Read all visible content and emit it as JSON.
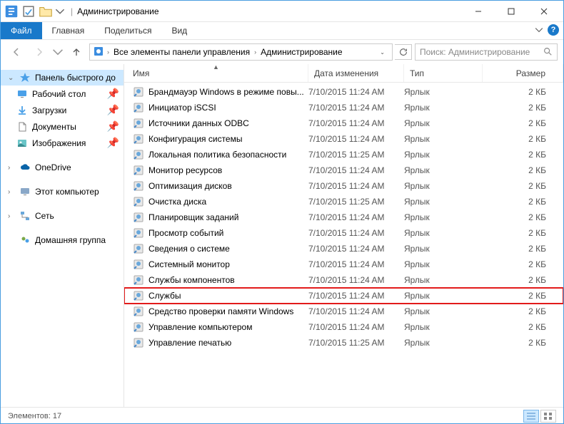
{
  "title": "Администрирование",
  "ribbon": {
    "file": "Файл",
    "home": "Главная",
    "share": "Поделиться",
    "view": "Вид"
  },
  "breadcrumb": {
    "seg1": "Все элементы панели управления",
    "seg2": "Администрирование"
  },
  "search_placeholder": "Поиск: Администрирование",
  "sidebar": {
    "quick_access": "Панель быстрого до",
    "desktop": "Рабочий стол",
    "downloads": "Загрузки",
    "documents": "Документы",
    "pictures": "Изображения",
    "onedrive": "OneDrive",
    "this_pc": "Этот компьютер",
    "network": "Сеть",
    "homegroup": "Домашняя группа"
  },
  "columns": {
    "name": "Имя",
    "date": "Дата изменения",
    "type": "Тип",
    "size": "Размер"
  },
  "type_label": "Ярлык",
  "files": [
    {
      "name": "Брандмауэр Windows в режиме повы...",
      "date": "7/10/2015 11:24 AM",
      "size": "2 КБ",
      "highlighted": false
    },
    {
      "name": "Инициатор iSCSI",
      "date": "7/10/2015 11:24 AM",
      "size": "2 КБ",
      "highlighted": false
    },
    {
      "name": "Источники данных ODBC",
      "date": "7/10/2015 11:24 AM",
      "size": "2 КБ",
      "highlighted": false
    },
    {
      "name": "Конфигурация системы",
      "date": "7/10/2015 11:24 AM",
      "size": "2 КБ",
      "highlighted": false
    },
    {
      "name": "Локальная политика безопасности",
      "date": "7/10/2015 11:25 AM",
      "size": "2 КБ",
      "highlighted": false
    },
    {
      "name": "Монитор ресурсов",
      "date": "7/10/2015 11:24 AM",
      "size": "2 КБ",
      "highlighted": false
    },
    {
      "name": "Оптимизация дисков",
      "date": "7/10/2015 11:24 AM",
      "size": "2 КБ",
      "highlighted": false
    },
    {
      "name": "Очистка диска",
      "date": "7/10/2015 11:25 AM",
      "size": "2 КБ",
      "highlighted": false
    },
    {
      "name": "Планировщик заданий",
      "date": "7/10/2015 11:24 AM",
      "size": "2 КБ",
      "highlighted": false
    },
    {
      "name": "Просмотр событий",
      "date": "7/10/2015 11:24 AM",
      "size": "2 КБ",
      "highlighted": false
    },
    {
      "name": "Сведения о системе",
      "date": "7/10/2015 11:24 AM",
      "size": "2 КБ",
      "highlighted": false
    },
    {
      "name": "Системный монитор",
      "date": "7/10/2015 11:24 AM",
      "size": "2 КБ",
      "highlighted": false
    },
    {
      "name": "Службы компонентов",
      "date": "7/10/2015 11:24 AM",
      "size": "2 КБ",
      "highlighted": false
    },
    {
      "name": "Службы",
      "date": "7/10/2015 11:24 AM",
      "size": "2 КБ",
      "highlighted": true
    },
    {
      "name": "Средство проверки памяти Windows",
      "date": "7/10/2015 11:24 AM",
      "size": "2 КБ",
      "highlighted": false
    },
    {
      "name": "Управление компьютером",
      "date": "7/10/2015 11:24 AM",
      "size": "2 КБ",
      "highlighted": false
    },
    {
      "name": "Управление печатью",
      "date": "7/10/2015 11:25 AM",
      "size": "2 КБ",
      "highlighted": false
    }
  ],
  "status": "Элементов: 17"
}
